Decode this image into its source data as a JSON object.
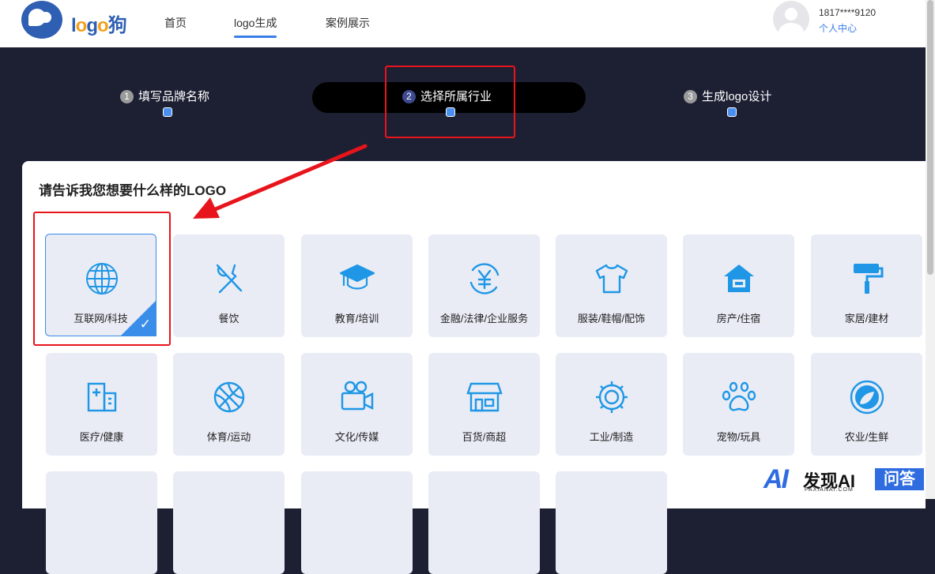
{
  "header": {
    "logo_text_a": "l",
    "logo_text_o1": "o",
    "logo_text_g": "g",
    "logo_text_o2": "o",
    "logo_text_cn": "狗",
    "nav": [
      "首页",
      "logo生成",
      "案例展示"
    ],
    "active_nav": "logo生成",
    "phone": "1817****9120",
    "user_center": "个人中心"
  },
  "steps": [
    {
      "num": "1",
      "label": "填写品牌名称"
    },
    {
      "num": "2",
      "label": "选择所属行业"
    },
    {
      "num": "3",
      "label": "生成logo设计"
    }
  ],
  "active_step": 2,
  "question": "请告诉我您想要什么样的LOGO",
  "industries_row1": [
    {
      "label": "互联网/科技",
      "icon": "globe-icon",
      "selected": true
    },
    {
      "label": "餐饮",
      "icon": "fork-knife-icon"
    },
    {
      "label": "教育/培训",
      "icon": "graduation-cap-icon"
    },
    {
      "label": "金融/法律/企业服务",
      "icon": "yen-icon"
    },
    {
      "label": "服装/鞋帽/配饰",
      "icon": "tshirt-icon"
    },
    {
      "label": "房产/住宿",
      "icon": "house-icon"
    },
    {
      "label": "家居/建材",
      "icon": "paint-roller-icon"
    }
  ],
  "industries_row2": [
    {
      "label": "医疗/健康",
      "icon": "hospital-icon"
    },
    {
      "label": "体育/运动",
      "icon": "basketball-icon"
    },
    {
      "label": "文化/传媒",
      "icon": "video-camera-icon"
    },
    {
      "label": "百货/商超",
      "icon": "store-icon"
    },
    {
      "label": "工业/制造",
      "icon": "gear-icon"
    },
    {
      "label": "宠物/玩具",
      "icon": "paw-icon"
    },
    {
      "label": "农业/生鲜",
      "icon": "leaf-icon"
    }
  ],
  "watermark": {
    "ai": "AI",
    "brand": "发现AI",
    "domain": "FAXIANAI.COM",
    "qa": "问答"
  },
  "colors": {
    "accent": "#3a8de8",
    "icon": "#1f97e6",
    "annotation": "#e8141b",
    "dark_bg": "#1d2033"
  }
}
